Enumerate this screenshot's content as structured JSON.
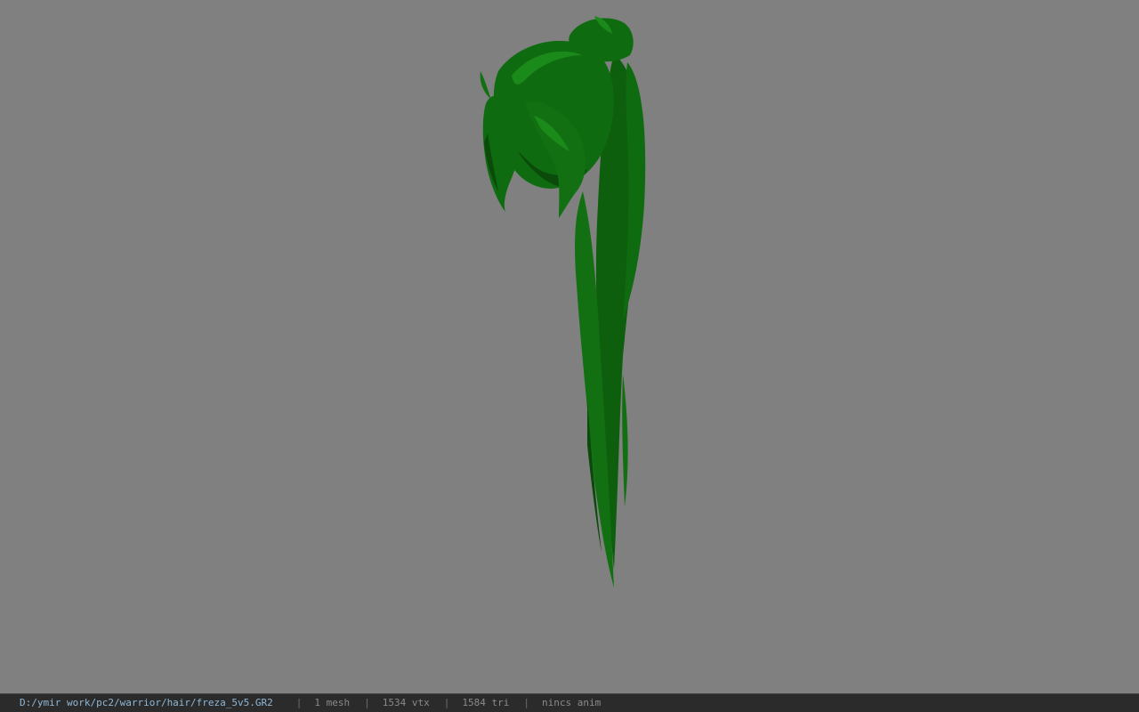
{
  "viewport": {
    "background_color": "#808080",
    "model_color": "#0f6b0f",
    "model_shadow_color": "#0a4a0a",
    "model_highlight_color": "#1a8a1a"
  },
  "status_bar": {
    "file_path": "D:/ymir work/pc2/warrior/hair/freza_5v5.GR2",
    "separator": "|",
    "mesh_count": "1 mesh",
    "vertex_count": "1534 vtx",
    "triangle_count": "1584 tri",
    "anim_info": "nincs anim"
  }
}
